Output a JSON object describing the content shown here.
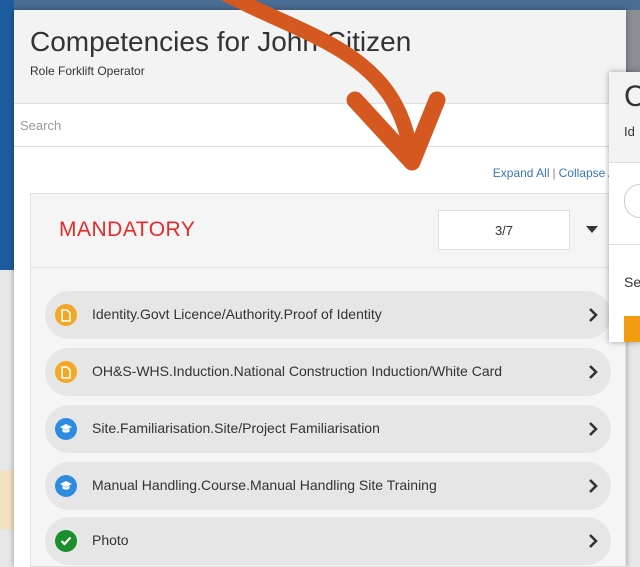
{
  "panel": {
    "title": "Competencies for John Citizen",
    "subtitle": "Role Forklift Operator",
    "search_placeholder": "Search",
    "expand_all": "Expand All",
    "separator": "|",
    "collapse_all": "Collapse A"
  },
  "section": {
    "title": "MANDATORY",
    "progress": "3/7",
    "items": [
      {
        "label": "Identity.Govt Licence/Authority.Proof of Identity",
        "icon": "document-icon",
        "color": "#f5a623"
      },
      {
        "label": "OH&S-WHS.Induction.National Construction Induction/White Card",
        "icon": "document-icon",
        "color": "#f5a623"
      },
      {
        "label": "Site.Familiarisation.Site/Project Familiarisation",
        "icon": "graduation-cap-icon",
        "color": "#2d8ce0"
      },
      {
        "label": "Manual Handling.Course.Manual Handling Site Training",
        "icon": "graduation-cap-icon",
        "color": "#2d8ce0"
      },
      {
        "label": "Photo",
        "icon": "checkmark-icon",
        "color": "#1a8f2b"
      }
    ]
  },
  "overlay": {
    "title_fragment": "C",
    "subtitle_fragment": "Id",
    "label_fragment": "Se"
  },
  "colors": {
    "annotation_arrow": "#d4581f",
    "mandatory_title": "#e52b2b",
    "link": "#3a76b6"
  }
}
